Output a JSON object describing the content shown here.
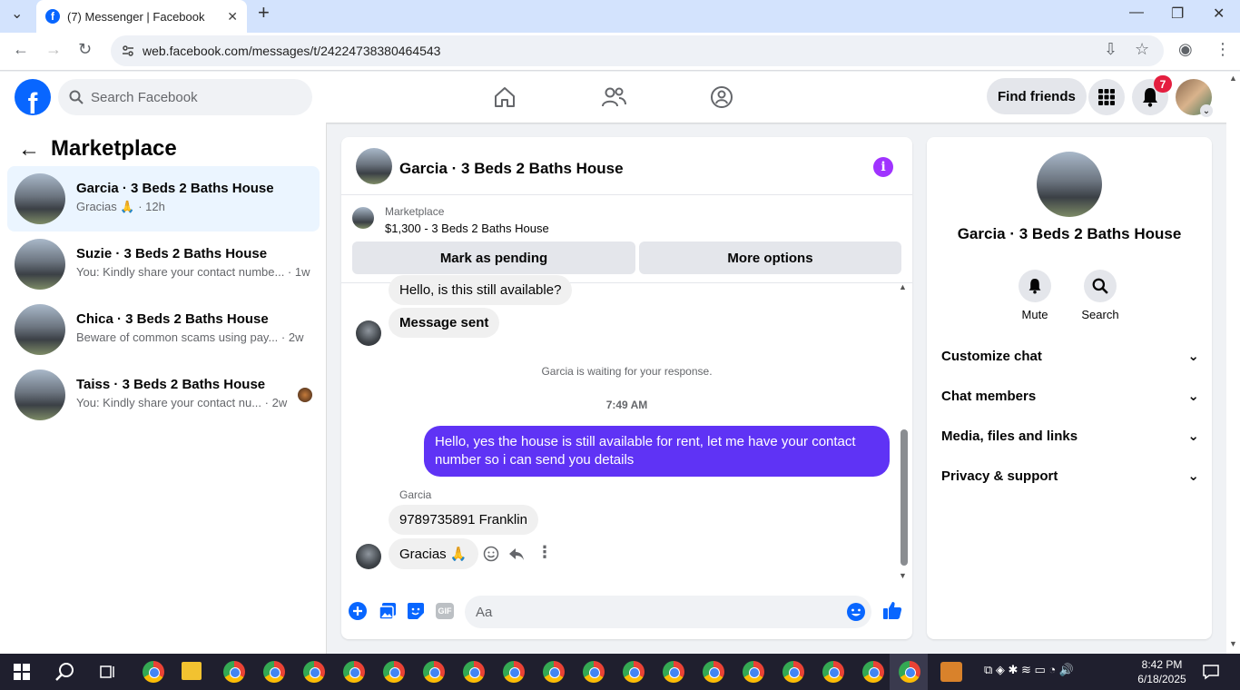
{
  "browser": {
    "tab_title": "(7) Messenger | Facebook",
    "url": "web.facebook.com/messages/t/24224738380464543"
  },
  "header": {
    "search_placeholder": "Search Facebook",
    "find_friends": "Find friends",
    "notification_count": "7"
  },
  "sidebar": {
    "title": "Marketplace",
    "conversations": [
      {
        "title": "Garcia · 3 Beds 2 Baths House",
        "snippet": "Gracias 🙏 · 12h"
      },
      {
        "title": "Suzie · 3 Beds 2 Baths House",
        "snippet": "You: Kindly share your contact numbe... · 1w"
      },
      {
        "title": "Chica · 3 Beds 2 Baths House",
        "snippet": "Beware of common scams using pay... · 2w"
      },
      {
        "title": "Taiss · 3 Beds 2 Baths House",
        "snippet": "You: Kindly share your contact nu... · 2w"
      }
    ]
  },
  "chat": {
    "title": "Garcia · 3 Beds 2 Baths House",
    "marketplace_label": "Marketplace",
    "listing": "$1,300 - 3 Beds 2 Baths House",
    "mark_pending": "Mark as pending",
    "more_options": "More options",
    "messages": {
      "m1": "Hello, is this still available?",
      "m2": "Message sent",
      "waiting": "Garcia is waiting for your response.",
      "time": "7:49 AM",
      "m3": "Hello, yes the house is still available for rent, let me have your contact number so i can send you  details",
      "sender": "Garcia",
      "m4": "9789735891 Franklin",
      "m5": "Gracias 🙏"
    },
    "input_placeholder": "Aa"
  },
  "info": {
    "name": "Garcia · 3 Beds 2 Baths House",
    "mute": "Mute",
    "search": "Search",
    "rows": [
      "Customize chat",
      "Chat members",
      "Media, files and links",
      "Privacy & support"
    ]
  },
  "taskbar": {
    "time": "8:42 PM",
    "date": "6/18/2025"
  },
  "colors": {
    "fb_blue": "#0866ff",
    "outgoing_bubble": "#5f33f5",
    "info_icon": "#a033ff"
  }
}
